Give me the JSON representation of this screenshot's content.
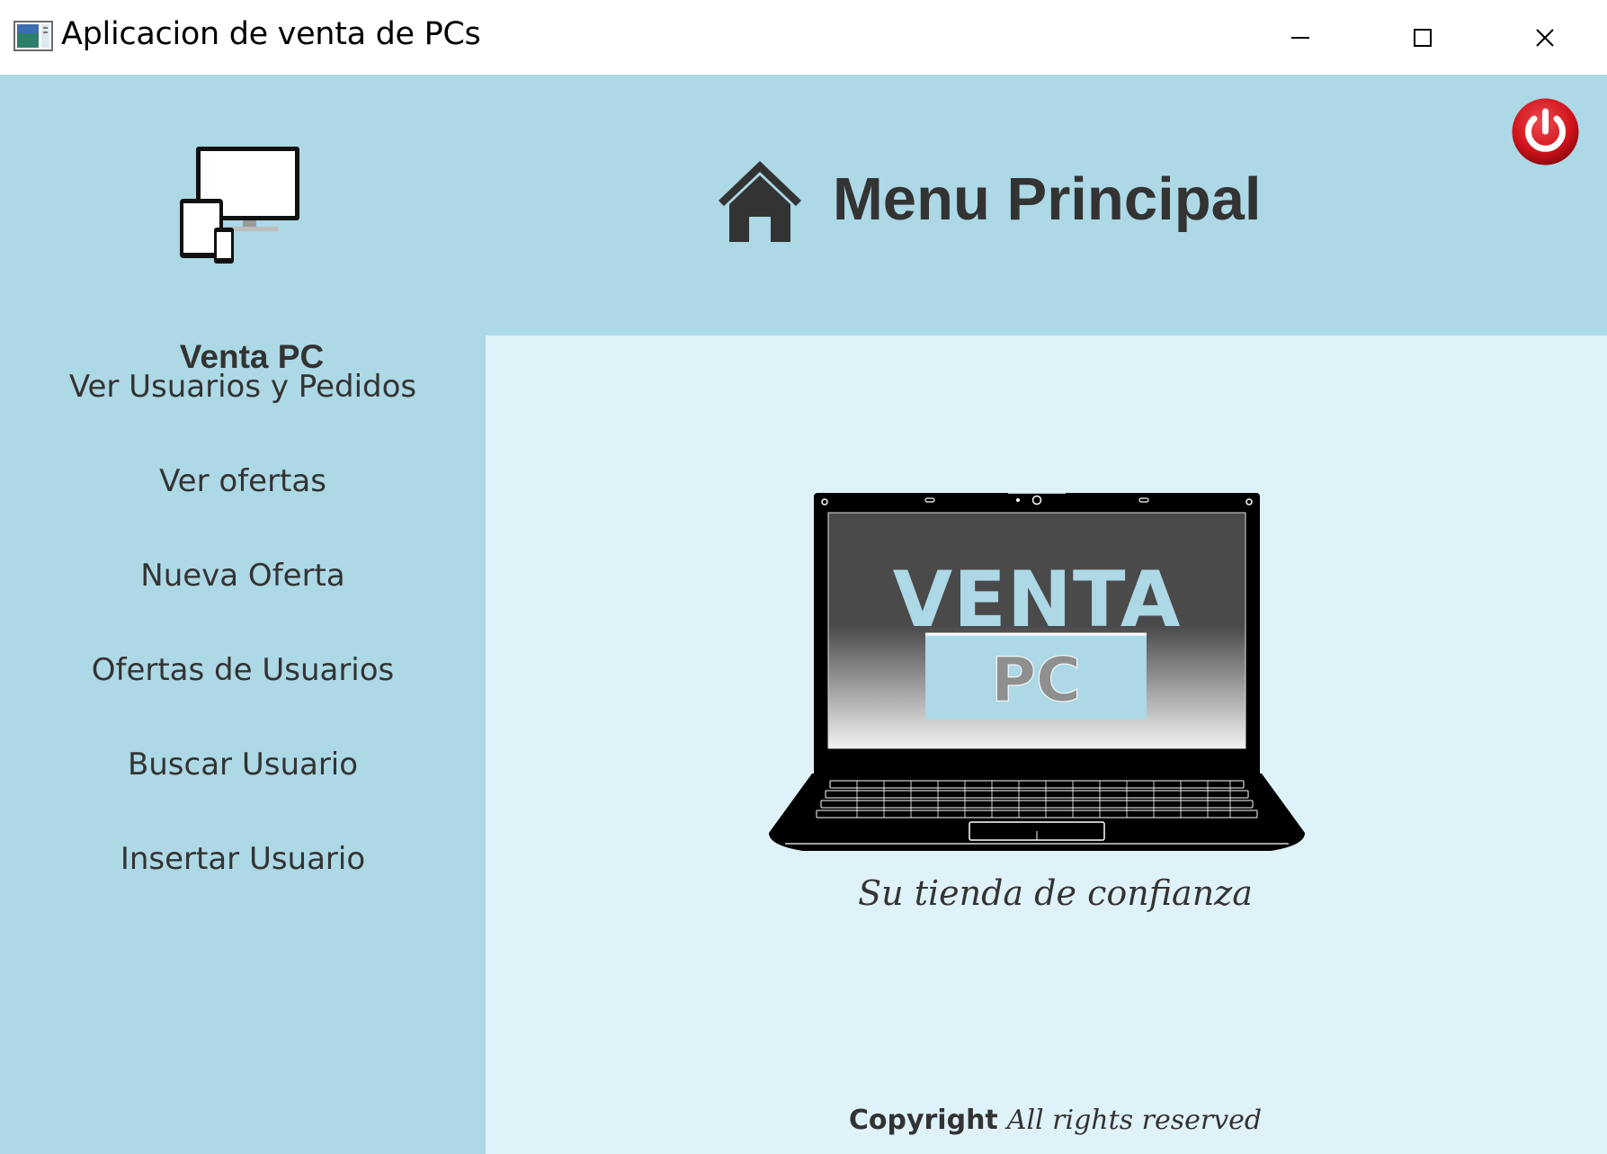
{
  "window": {
    "title": "Aplicacion de venta de PCs",
    "controls": {
      "minimize": "minimize-icon",
      "maximize": "maximize-icon",
      "close": "close-icon"
    }
  },
  "brand": {
    "name": "Venta PC",
    "icon": "devices-icon"
  },
  "header": {
    "icon": "home-icon",
    "title": "Menu Principal"
  },
  "power": {
    "icon": "power-icon",
    "color": "#d0121b"
  },
  "nav": {
    "items": [
      {
        "label": "Ver Usuarios y Pedidos"
      },
      {
        "label": "Ver ofertas"
      },
      {
        "label": "Nueva Oferta"
      },
      {
        "label": "Ofertas de Usuarios"
      },
      {
        "label": "Buscar Usuario"
      },
      {
        "label": "Insertar Usuario"
      }
    ]
  },
  "hero": {
    "screen_line1": "VENTA",
    "screen_line2": "PC",
    "tagline": "Su tienda de confianza"
  },
  "footer": {
    "copyright": "Copyright",
    "rights": "All rights reserved"
  },
  "colors": {
    "sidebar_bg": "#add8e6",
    "content_bg": "#e0f2f9",
    "text": "#333333",
    "accent_red": "#d0121b"
  }
}
